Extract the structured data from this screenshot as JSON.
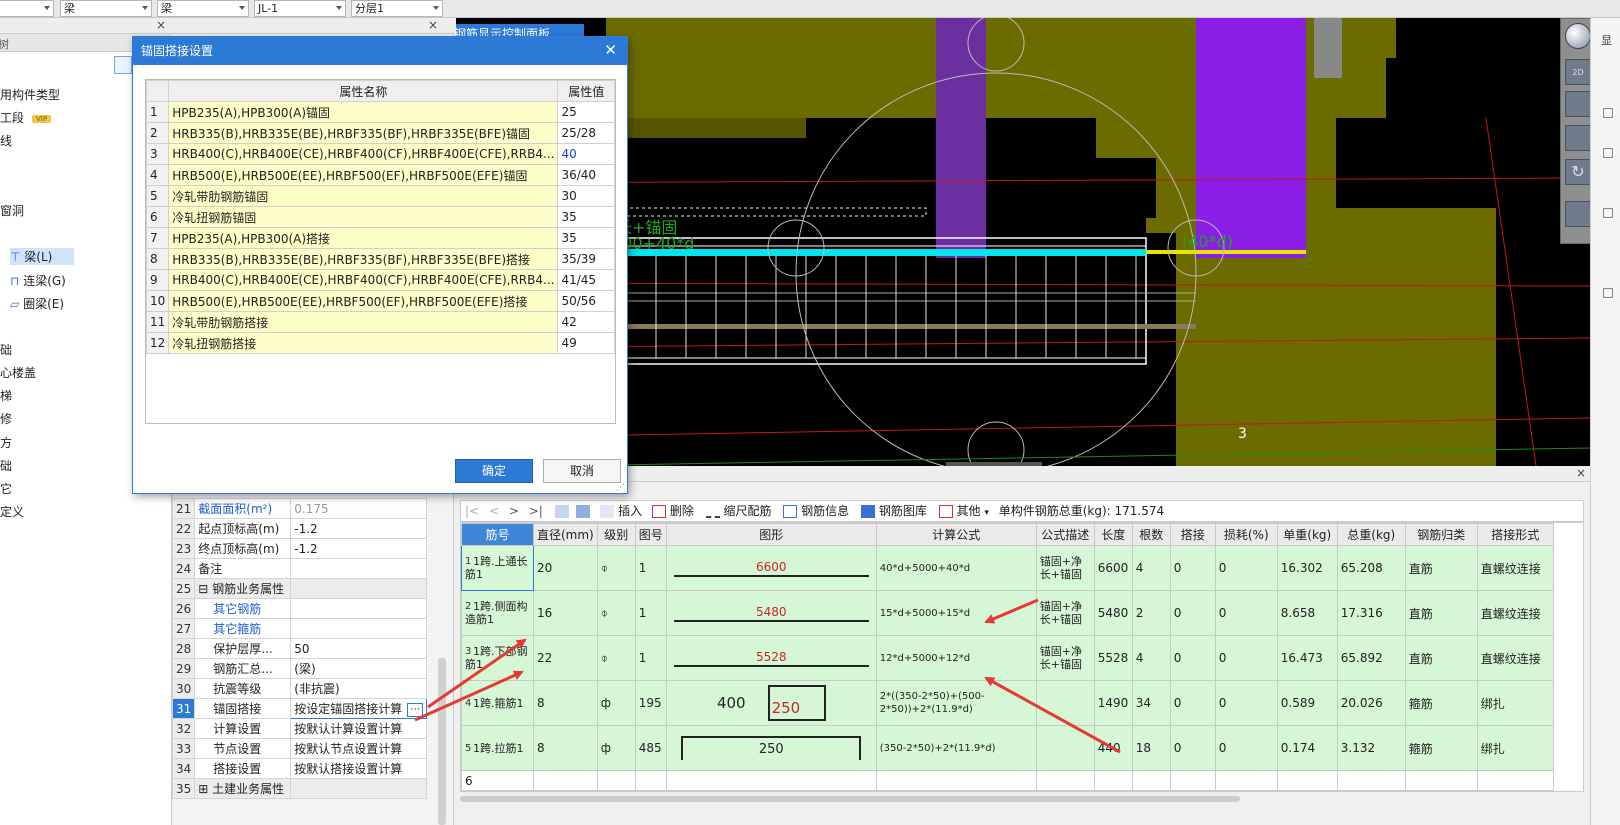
{
  "topbar": {
    "combo1": "梁",
    "combo2": "梁",
    "combo3": "JL-1",
    "combo4": "分层1"
  },
  "left_panel": {
    "items": [
      "用构件类型",
      "工段",
      "线",
      "窗洞",
      "梁(L)",
      "连梁(G)",
      "圈梁(E)",
      "础",
      "心楼盖",
      "梯",
      "修",
      "方",
      "础",
      "它",
      "定义"
    ],
    "vip": "VIP"
  },
  "viewport": {
    "title": "钢筋显示控制面板",
    "label_green_1": "长+锚固",
    "label_green_2": "500+40*d",
    "label_green_3": "(40*d)",
    "marker": "3"
  },
  "props": {
    "rows": [
      {
        "num": "21",
        "name": "截面面积(m²)",
        "value": "0.175",
        "blue": true
      },
      {
        "num": "22",
        "name": "起点顶标高(m)",
        "value": "-1.2"
      },
      {
        "num": "23",
        "name": "终点顶标高(m)",
        "value": "-1.2"
      },
      {
        "num": "24",
        "name": "备注",
        "value": ""
      },
      {
        "num": "25",
        "name": "钢筋业务属性",
        "value": "",
        "group": true
      },
      {
        "num": "26",
        "name": "其它钢筋",
        "value": "",
        "blue": true,
        "indent": true
      },
      {
        "num": "27",
        "name": "其它箍筋",
        "value": "",
        "blue": true,
        "indent": true
      },
      {
        "num": "28",
        "name": "保护层厚...",
        "value": "50",
        "indent": true
      },
      {
        "num": "29",
        "name": "钢筋汇总...",
        "value": "(梁)",
        "indent": true
      },
      {
        "num": "30",
        "name": "抗震等级",
        "value": "(非抗震)",
        "indent": true
      },
      {
        "num": "31",
        "name": "锚固搭接",
        "value": "按设定锚固搭接计算",
        "indent": true,
        "selected": true
      },
      {
        "num": "32",
        "name": "计算设置",
        "value": "按默认计算设置计算",
        "indent": true
      },
      {
        "num": "33",
        "name": "节点设置",
        "value": "按默认节点设置计算",
        "indent": true
      },
      {
        "num": "34",
        "name": "搭接设置",
        "value": "按默认搭接设置计算",
        "indent": true
      },
      {
        "num": "35",
        "name": "土建业务属性",
        "value": "",
        "group": true
      }
    ]
  },
  "toolbar": {
    "insert": "插入",
    "delete": "删除",
    "scale": "缩尺配筋",
    "info": "钢筋信息",
    "library": "钢筋图库",
    "other": "其他",
    "total": "单构件钢筋总重(kg): 171.574"
  },
  "grid": {
    "headers": [
      "筋号",
      "直径(mm)",
      "级别",
      "图号",
      "图形",
      "计算公式",
      "公式描述",
      "长度",
      "根数",
      "搭接",
      "损耗(%)",
      "单重(kg)",
      "总重(kg)",
      "钢筋归类",
      "搭接形式"
    ],
    "rows": [
      {
        "n": "1",
        "name": "1跨.上通长筋1",
        "d": "20",
        "grade": "⌽",
        "fig": "1",
        "shape": "6600",
        "formula": "40*d+5000+40*d",
        "desc": "锚固+净长+锚固",
        "len": "6600",
        "count": "4",
        "lap": "0",
        "loss": "0",
        "unit": "16.302",
        "total": "65.208",
        "cat": "直筋",
        "form": "直螺纹连接"
      },
      {
        "n": "2",
        "name": "1跨.侧面构造筋1",
        "d": "16",
        "grade": "⌽",
        "fig": "1",
        "shape": "5480",
        "formula": "15*d+5000+15*d",
        "desc": "锚固+净长+锚固",
        "len": "5480",
        "count": "2",
        "lap": "0",
        "loss": "0",
        "unit": "8.658",
        "total": "17.316",
        "cat": "直筋",
        "form": "直螺纹连接"
      },
      {
        "n": "3",
        "name": "1跨.下部钢筋1",
        "d": "22",
        "grade": "⌽",
        "fig": "1",
        "shape": "5528",
        "formula": "12*d+5000+12*d",
        "desc": "锚固+净长+锚固",
        "len": "5528",
        "count": "4",
        "lap": "0",
        "loss": "0",
        "unit": "16.473",
        "total": "65.892",
        "cat": "直筋",
        "form": "直螺纹连接"
      },
      {
        "n": "4",
        "name": "1跨.箍筋1",
        "d": "8",
        "grade": "ф",
        "fig": "195",
        "shape_a": "400",
        "shape_b": "250",
        "formula": "2*((350-2*50)+(500-2*50))+2*(11.9*d)",
        "desc": "",
        "len": "1490",
        "count": "34",
        "lap": "0",
        "loss": "0",
        "unit": "0.589",
        "total": "20.026",
        "cat": "箍筋",
        "form": "绑扎"
      },
      {
        "n": "5",
        "name": "1跨.拉筋1",
        "d": "8",
        "grade": "ф",
        "fig": "485",
        "shape": "250",
        "formula": "(350-2*50)+2*(11.9*d)",
        "desc": "",
        "len": "440",
        "count": "18",
        "lap": "0",
        "loss": "0",
        "unit": "0.174",
        "total": "3.132",
        "cat": "箍筋",
        "form": "绑扎"
      },
      {
        "n": "6"
      }
    ]
  },
  "dialog": {
    "title": "锚固搭接设置",
    "col_name": "属性名称",
    "col_value": "属性值",
    "rows": [
      {
        "n": "1",
        "name": "HPB235(A),HPB300(A)锚固",
        "value": "25"
      },
      {
        "n": "2",
        "name": "HRB335(B),HRB335E(BE),HRBF335(BF),HRBF335E(BFE)锚固",
        "value": "25/28"
      },
      {
        "n": "3",
        "name": "HRB400(C),HRB400E(CE),HRBF400(CF),HRBF400E(CFE),RRB4...",
        "value": "40",
        "value_blue": true
      },
      {
        "n": "4",
        "name": "HRB500(E),HRB500E(EE),HRBF500(EF),HRBF500E(EFE)锚固",
        "value": "36/40"
      },
      {
        "n": "5",
        "name": "冷轧带肋钢筋锚固",
        "value": "30"
      },
      {
        "n": "6",
        "name": "冷轧扭钢筋锚固",
        "value": "35"
      },
      {
        "n": "7",
        "name": "HPB235(A),HPB300(A)搭接",
        "value": "35"
      },
      {
        "n": "8",
        "name": "HRB335(B),HRB335E(BE),HRBF335(BF),HRBF335E(BFE)搭接",
        "value": "35/39"
      },
      {
        "n": "9",
        "name": "HRB400(C),HRB400E(CE),HRBF400(CF),HRBF400E(CFE),RRB4...",
        "value": "41/45"
      },
      {
        "n": "10",
        "name": "HRB500(E),HRB500E(EE),HRBF500(EF),HRBF500E(EFE)搭接",
        "value": "50/56"
      },
      {
        "n": "11",
        "name": "冷轧带肋钢筋搭接",
        "value": "42"
      },
      {
        "n": "12",
        "name": "冷轧扭钢筋搭接",
        "value": "49"
      }
    ],
    "ok": "确定",
    "cancel": "取消"
  },
  "colors": {
    "accent": "#2c7ad6",
    "green_row": "#d6f7d6",
    "yellow_cell": "#fdfdc8",
    "arrow": "#e53935"
  }
}
